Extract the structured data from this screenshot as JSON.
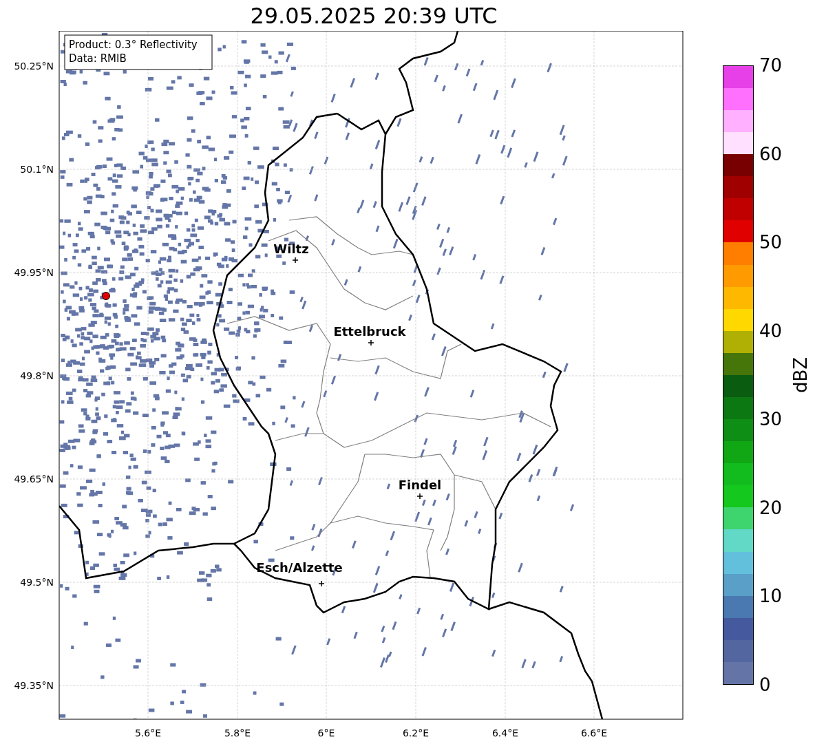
{
  "title": "29.05.2025 20:39 UTC",
  "info_box": {
    "lines": [
      "Product: 0.3° Reflectivity",
      "Data: RMIB"
    ]
  },
  "map": {
    "y_ticks": [
      "50.25°N",
      "50.1°N",
      "49.95°N",
      "49.8°N",
      "49.65°N",
      "49.5°N",
      "49.35°N"
    ],
    "x_ticks": [
      "5.6°E",
      "5.8°E",
      "6°E",
      "6.2°E",
      "6.4°E",
      "6.6°E"
    ],
    "cities": [
      {
        "name": "Wiltz"
      },
      {
        "name": "Ettelbruck"
      },
      {
        "name": "Findel"
      },
      {
        "name": "Esch/Alzette"
      }
    ]
  },
  "colorbar": {
    "label": "dBZ",
    "ticks": [
      "70",
      "60",
      "50",
      "40",
      "30",
      "20",
      "10",
      "0"
    ],
    "bins": [
      {
        "color": "#6474a6"
      },
      {
        "color": "#5466a0"
      },
      {
        "color": "#44599e"
      },
      {
        "color": "#4a78b0"
      },
      {
        "color": "#5a9fc8"
      },
      {
        "color": "#62c0dc"
      },
      {
        "color": "#62d8c6"
      },
      {
        "color": "#3ed46e"
      },
      {
        "color": "#14c81e"
      },
      {
        "color": "#12bc1e"
      },
      {
        "color": "#10a614"
      },
      {
        "color": "#0e8e14"
      },
      {
        "color": "#0c7812"
      },
      {
        "color": "#0a5c10"
      },
      {
        "color": "#46760a"
      },
      {
        "color": "#b0b004"
      },
      {
        "color": "#ffd800"
      },
      {
        "color": "#ffb800"
      },
      {
        "color": "#ff9a00"
      },
      {
        "color": "#ff7e00"
      },
      {
        "color": "#e00000"
      },
      {
        "color": "#c00000"
      },
      {
        "color": "#a00000"
      },
      {
        "color": "#780000"
      },
      {
        "color": "#ffe0ff"
      },
      {
        "color": "#ffb0ff"
      },
      {
        "color": "#ff70ff"
      },
      {
        "color": "#e840e8"
      }
    ]
  }
}
